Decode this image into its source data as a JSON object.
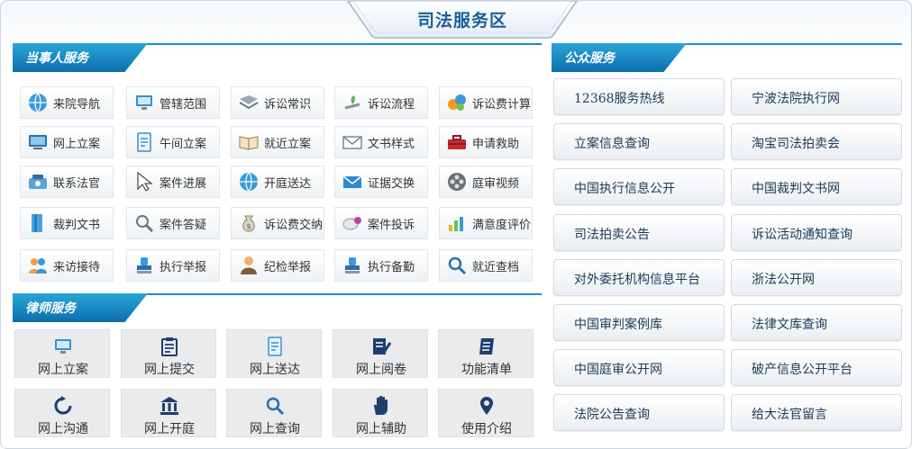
{
  "title": "司法服务区",
  "sections": {
    "party": "当事人服务",
    "lawyer": "律师服务",
    "public": "公众服务"
  },
  "party_items": [
    {
      "label": "来院导航",
      "icon": "globe-icon"
    },
    {
      "label": "管辖范围",
      "icon": "monitor-icon"
    },
    {
      "label": "诉讼常识",
      "icon": "book-icon"
    },
    {
      "label": "诉讼流程",
      "icon": "plant-icon"
    },
    {
      "label": "诉讼费计算",
      "icon": "bubbles-icon"
    },
    {
      "label": "网上立案",
      "icon": "computer-icon"
    },
    {
      "label": "午间立案",
      "icon": "document-icon"
    },
    {
      "label": "就近立案",
      "icon": "open-book-icon"
    },
    {
      "label": "文书样式",
      "icon": "envelope-icon"
    },
    {
      "label": "申请救助",
      "icon": "toolbox-icon"
    },
    {
      "label": "联系法官",
      "icon": "phone-icon"
    },
    {
      "label": "案件进展",
      "icon": "cursor-icon"
    },
    {
      "label": "开庭送达",
      "icon": "globe-icon"
    },
    {
      "label": "证据交换",
      "icon": "mail-icon"
    },
    {
      "label": "庭审视频",
      "icon": "film-icon"
    },
    {
      "label": "裁判文书",
      "icon": "folder-icon"
    },
    {
      "label": "案件答疑",
      "icon": "magnifier-icon"
    },
    {
      "label": "诉讼费交纳",
      "icon": "money-bag-icon"
    },
    {
      "label": "案件投诉",
      "icon": "disc-icon"
    },
    {
      "label": "满意度评价",
      "icon": "chart-icon"
    },
    {
      "label": "来访接待",
      "icon": "people-icon"
    },
    {
      "label": "执行举报",
      "icon": "stamp-icon"
    },
    {
      "label": "纪检举报",
      "icon": "person-icon"
    },
    {
      "label": "执行备勤",
      "icon": "stamp-icon"
    },
    {
      "label": "就近查档",
      "icon": "search-icon"
    }
  ],
  "lawyer_items": [
    {
      "label": "网上立案",
      "icon": "monitor-icon"
    },
    {
      "label": "网上提交",
      "icon": "clipboard-icon"
    },
    {
      "label": "网上送达",
      "icon": "document-icon"
    },
    {
      "label": "网上阅卷",
      "icon": "edit-icon"
    },
    {
      "label": "功能清单",
      "icon": "list-icon"
    },
    {
      "label": "网上沟通",
      "icon": "refresh-icon"
    },
    {
      "label": "网上开庭",
      "icon": "court-icon"
    },
    {
      "label": "网上查询",
      "icon": "search-icon"
    },
    {
      "label": "网上辅助",
      "icon": "hand-icon"
    },
    {
      "label": "使用介绍",
      "icon": "location-icon"
    }
  ],
  "public_items": [
    "12368服务热线",
    "宁波法院执行网",
    "立案信息查询",
    "淘宝司法拍卖会",
    "中国执行信息公开",
    "中国裁判文书网",
    "司法拍卖公告",
    "诉讼活动通知查询",
    "对外委托机构信息平台",
    "浙法公开网",
    "中国审判案例库",
    "法律文库查询",
    "中国庭审公开网",
    "破产信息公开平台",
    "法院公告查询",
    "给大法官留言"
  ],
  "colors": {
    "accent": "#1a8ccd",
    "header_dark": "#0b6fae",
    "title": "#1a5d99"
  }
}
